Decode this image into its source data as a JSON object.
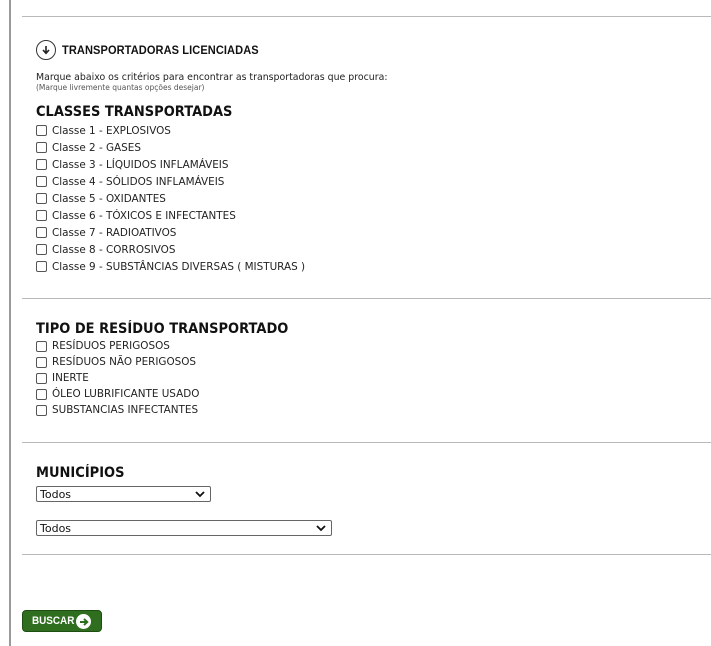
{
  "header": {
    "title": "TRANSPORTADORAS LICENCIADAS",
    "icon": "circle-arrow-down-icon",
    "instruction": "Marque abaixo os critérios para encontrar as transportadoras que procura:",
    "instruction_note": "(Marque livremente quantas opções desejar)"
  },
  "classes": {
    "title": "CLASSES TRANSPORTADAS",
    "items": [
      {
        "label": "Classe 1 - EXPLOSIVOS",
        "checked": false
      },
      {
        "label": "Classe 2 - GASES",
        "checked": false
      },
      {
        "label": "Classe 3 - LÍQUIDOS INFLAMÁVEIS",
        "checked": false
      },
      {
        "label": "Classe 4 - SÓLIDOS INFLAMÁVEIS",
        "checked": false
      },
      {
        "label": "Classe 5 - OXIDANTES",
        "checked": false
      },
      {
        "label": "Classe 6 - TÓXICOS E INFECTANTES",
        "checked": false
      },
      {
        "label": "Classe 7 - RADIOATIVOS",
        "checked": false
      },
      {
        "label": "Classe 8 - CORROSIVOS",
        "checked": false
      },
      {
        "label": "Classe 9 - SUBSTÂNCIAS DIVERSAS ( MISTURAS )",
        "checked": false
      }
    ]
  },
  "residuos": {
    "title": "TIPO DE RESÍDUO TRANSPORTADO",
    "items": [
      {
        "label": "RESÍDUOS PERIGOSOS",
        "checked": false
      },
      {
        "label": "RESÍDUOS NÃO PERIGOSOS",
        "checked": false
      },
      {
        "label": "INERTE",
        "checked": false
      },
      {
        "label": "ÓLEO LUBRIFICANTE USADO",
        "checked": false
      },
      {
        "label": "SUBSTANCIAS INFECTANTES",
        "checked": false
      }
    ]
  },
  "municipios": {
    "title": "MUNICÍPIOS",
    "select1": {
      "value": "Todos"
    },
    "select2": {
      "value": "Todos"
    }
  },
  "search": {
    "label": "BUSCAR",
    "icon": "circle-arrow-right-icon",
    "color": "#2f6d1f"
  }
}
